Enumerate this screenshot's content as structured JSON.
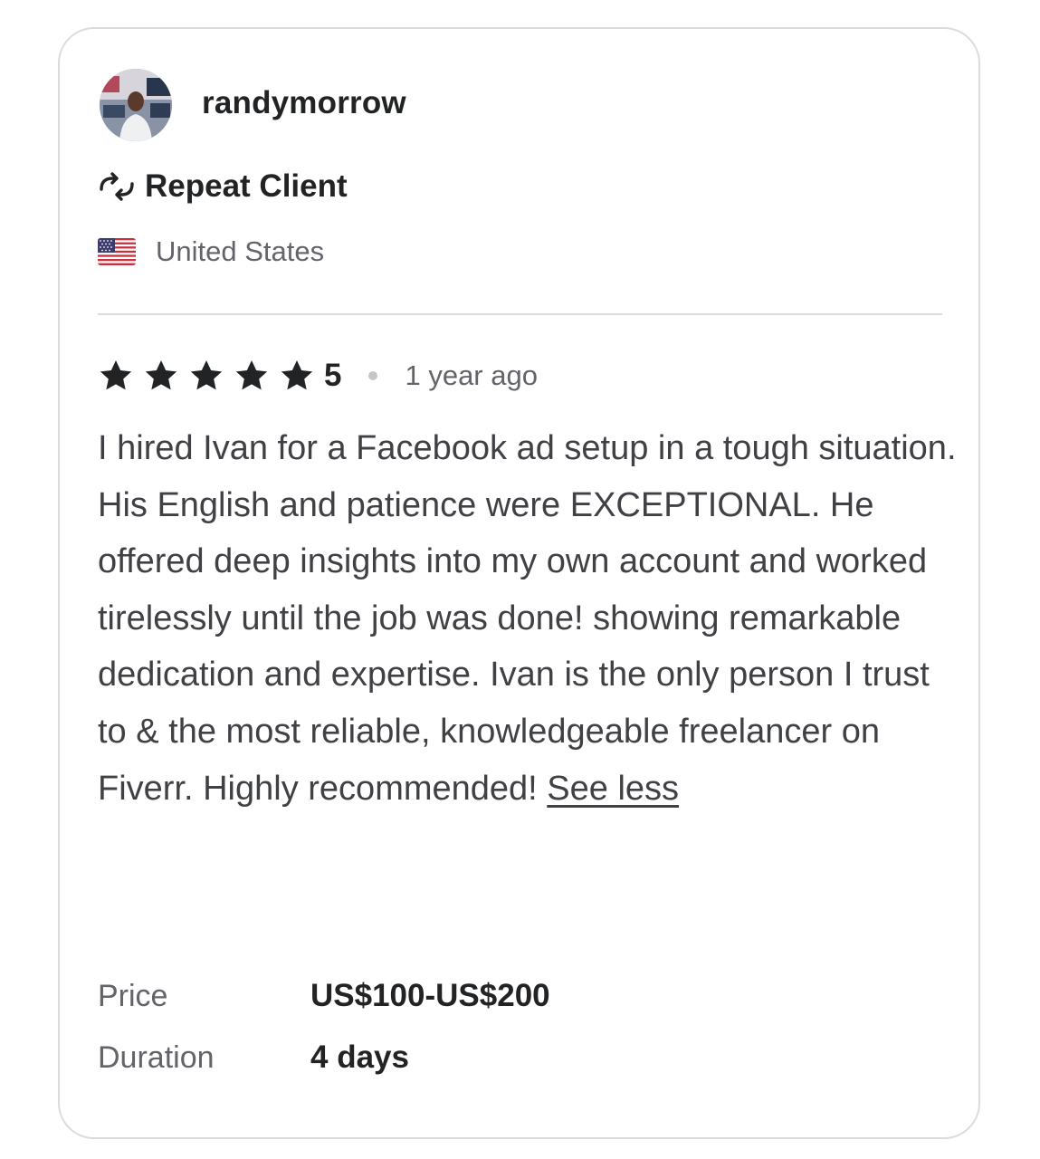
{
  "reviewer": {
    "username": "randymorrow",
    "badge_label": "Repeat Client",
    "badge_icon": "repeat-icon",
    "country": "United States",
    "country_flag": "us-flag-icon"
  },
  "review": {
    "rating": 5,
    "rating_label": "5",
    "stars_filled": 5,
    "star_color": "#222325",
    "time_ago": "1 year ago",
    "text": "I hired Ivan for a Facebook ad setup in a tough situation. His English and patience were EXCEPTIONAL. He offered deep insights into my own account and worked tirelessly until the job was done! showing remarkable dedication and expertise. Ivan is the only person I trust to & the most reliable, knowledgeable freelancer on Fiverr. Highly recommended!",
    "toggle_label": "See less"
  },
  "details": [
    {
      "label": "Price",
      "value": "US$100-US$200"
    },
    {
      "label": "Duration",
      "value": "4 days"
    }
  ]
}
